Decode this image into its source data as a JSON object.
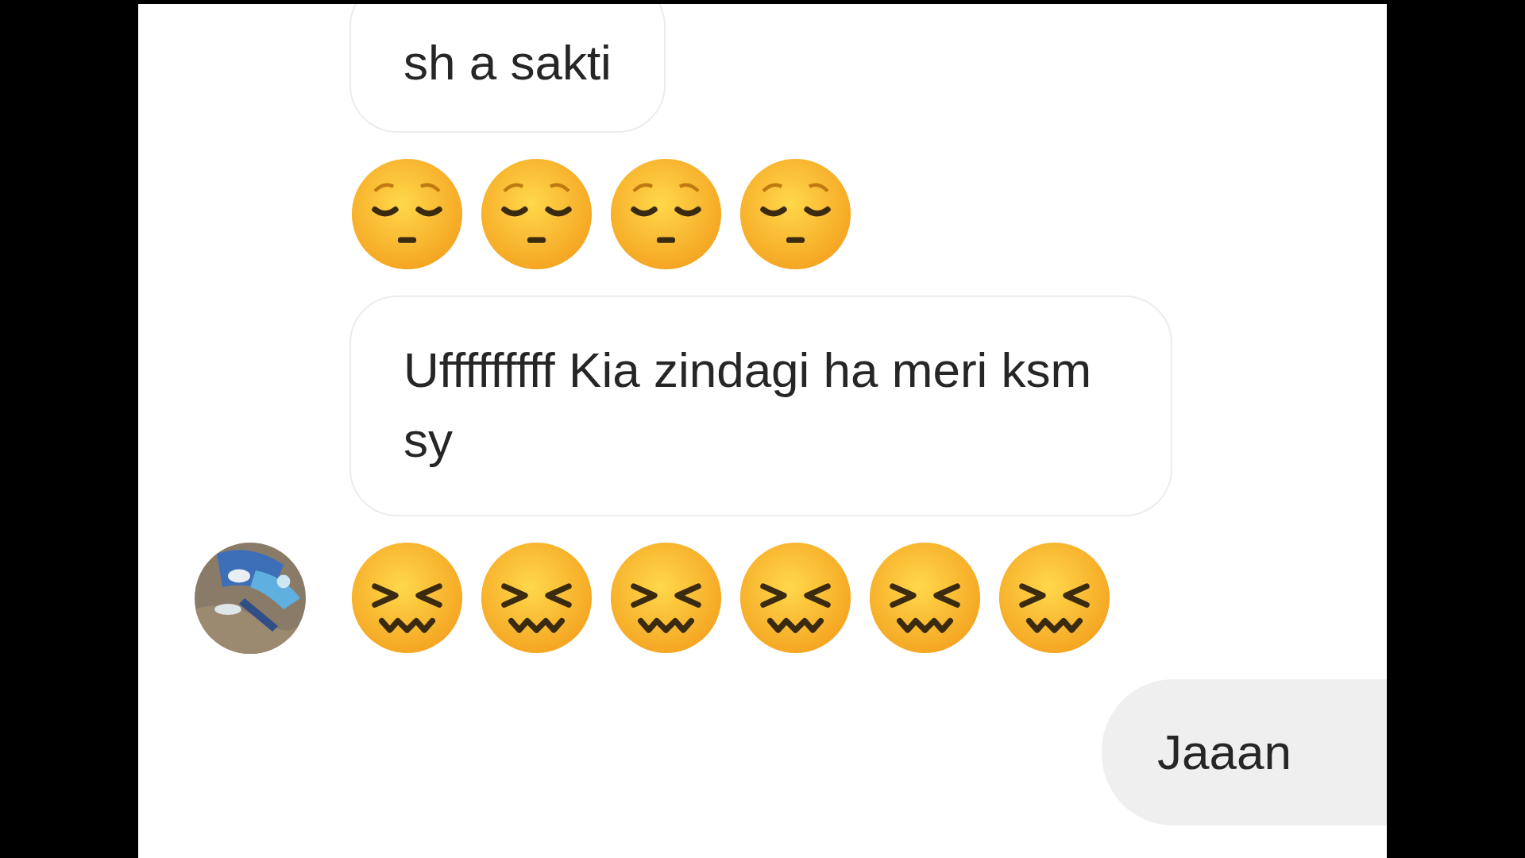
{
  "messages": [
    {
      "kind": "text",
      "sent": false,
      "cut_top": true,
      "text": "sh a sakti"
    },
    {
      "kind": "emoji",
      "sent": false,
      "emojis": [
        {
          "kind": "pensive"
        },
        {
          "kind": "pensive"
        },
        {
          "kind": "pensive"
        },
        {
          "kind": "pensive"
        }
      ]
    },
    {
      "kind": "text",
      "sent": false,
      "cut_top": false,
      "text": "Ufffffffff Kia zindagi ha meri ksm sy"
    },
    {
      "kind": "emoji",
      "sent": false,
      "emojis": [
        {
          "kind": "confounded"
        },
        {
          "kind": "confounded"
        },
        {
          "kind": "confounded"
        },
        {
          "kind": "confounded"
        },
        {
          "kind": "confounded"
        },
        {
          "kind": "confounded"
        }
      ]
    },
    {
      "kind": "text",
      "sent": true,
      "cut_top": false,
      "text": "Jaaan"
    }
  ]
}
